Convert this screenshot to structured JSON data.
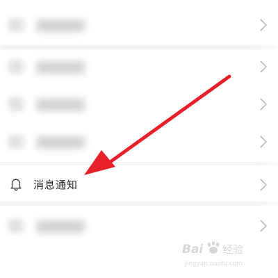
{
  "settings_list": {
    "notification_item": {
      "label": "消息通知",
      "icon": "bell-icon"
    },
    "other_items": [
      {
        "blurred": true
      },
      {
        "blurred": true
      },
      {
        "blurred": true
      },
      {
        "blurred": true
      },
      {
        "blurred": true
      }
    ]
  },
  "annotation": {
    "arrow_color": "#e8202a"
  },
  "watermark": {
    "logo": "baidu-jingyan-logo",
    "text": "Baidu 经验",
    "url": "jingyan.baidu.com"
  }
}
